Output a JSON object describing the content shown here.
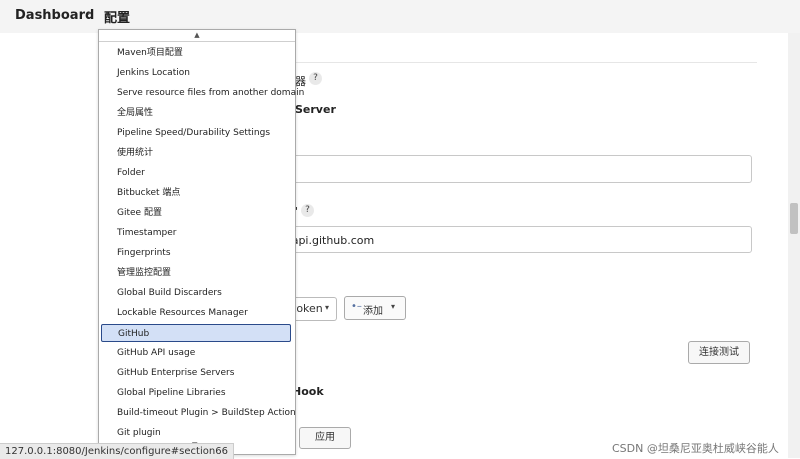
{
  "breadcrumb": {
    "dashboard": "Dashboard",
    "separator": "›",
    "current": "配置"
  },
  "bg": {
    "frag1": "器",
    "frag2": "Server",
    "frag3": "Hook",
    "frag4": "\"",
    "api_url": "/api.github.com",
    "credentials_select": "token",
    "add_button": "添加",
    "test_button": "连接测试",
    "apply_button": "应用",
    "help": "?"
  },
  "dropdown": {
    "selected_index": 14,
    "items": [
      "Maven项目配置",
      "Jenkins Location",
      "Serve resource files from another domain",
      "全局属性",
      "Pipeline Speed/Durability Settings",
      "使用统计",
      "Folder",
      "Bitbucket 端点",
      "Gitee 配置",
      "Timestamper",
      "Fingerprints",
      "管理监控配置",
      "Global Build Discarders",
      "Lockable Resources Manager",
      "GitHub",
      "GitHub API usage",
      "GitHub Enterprise Servers",
      "Global Pipeline Libraries",
      "Build-timeout Plugin > BuildStep Action",
      "Git plugin"
    ]
  },
  "status_url": "127.0.0.1:8080/Jenkins/configure#section66",
  "watermark": "CSDN @坦桑尼亚奥杜威峡谷能人",
  "colors": {
    "selected_bg": "#d3e0f6",
    "selected_border": "#2a4a8a",
    "topbar": "#f4f4f4"
  }
}
